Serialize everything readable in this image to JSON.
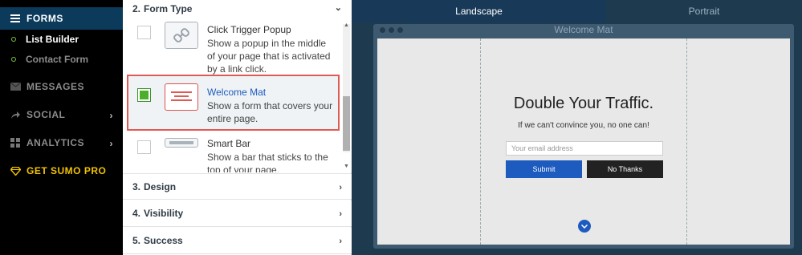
{
  "sidebar": {
    "forms": "FORMS",
    "sub_items": [
      "List Builder",
      "Contact Form"
    ],
    "messages": "MESSAGES",
    "social": "SOCIAL",
    "analytics": "ANALYTICS",
    "sumo": "GET SUMO PRO",
    "colors": {
      "active_bg": "#0b3a5b",
      "dot": "#7cbf3a",
      "sumo": "#f2c200"
    },
    "icons": [
      "forms-icon",
      "envelope-icon",
      "share-arrow-icon",
      "analytics-grid-icon",
      "diamond-icon"
    ]
  },
  "panel": {
    "form_type_section": {
      "num": "2.",
      "label": "Form Type"
    },
    "options": [
      {
        "title": "Click Trigger Popup",
        "desc": "Show a popup in the middle of your page that is activated by a link click.",
        "icon": "link-icon",
        "checked": false
      },
      {
        "title": "Welcome Mat",
        "desc": "Show a form that covers your entire page.",
        "icon": "welcome-mat-icon",
        "checked": true
      },
      {
        "title": "Smart Bar",
        "desc": "Show a bar that sticks to the top of your page.",
        "icon": "smart-bar-icon",
        "checked": false
      }
    ],
    "sections": [
      {
        "num": "3.",
        "label": "Design"
      },
      {
        "num": "4.",
        "label": "Visibility"
      },
      {
        "num": "5.",
        "label": "Success"
      }
    ],
    "colors": {
      "selection_border": "#e05a55",
      "check": "#4caf2a",
      "selected_title": "#1e5bbf"
    }
  },
  "preview": {
    "tabs": [
      "Landscape",
      "Portrait"
    ],
    "active_tab": "Landscape",
    "browser_title": "Welcome Mat",
    "heading": "Double Your Traffic.",
    "subheading": "If we can't convince you, no one can!",
    "email_placeholder": "Your email address",
    "submit": "Submit",
    "no_thanks": "No Thanks",
    "colors": {
      "bg": "#1e3a4f",
      "submit": "#1e5bbf",
      "no_thanks": "#222222"
    }
  }
}
